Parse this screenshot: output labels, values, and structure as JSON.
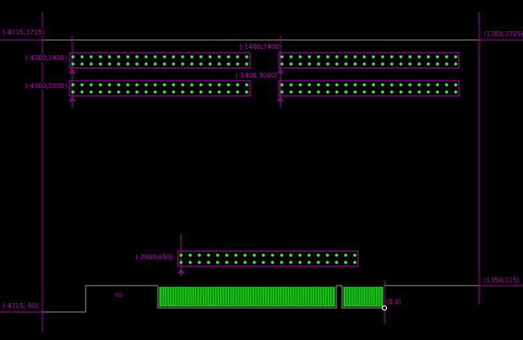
{
  "colors": {
    "background": "#000000",
    "outline": "#9a9a9a",
    "marker": "#b000b0",
    "connector_outline": "#c000c0",
    "pin": "#22ff22",
    "finger": "#0a8a0a",
    "finger_edge": "#2cff2c",
    "origin_marker": "#ffffff"
  },
  "labels": {
    "top_left": "(-4715,3715)",
    "top_right": "(1350,3715)",
    "hdr1_left": "(-4300,3400)",
    "hdr1_right": "(-1400,3400)",
    "hdr2_left": "(-4300,3000)",
    "hdr2_right": "(-1400,3000)",
    "hdr3": "(-2800,650)",
    "bottom_left": "(-4715,-50)",
    "bottom_right": "(1350,315)",
    "origin": "(0,0)",
    "note": "no"
  },
  "connectors": {
    "row_pin_count": 20,
    "lower_pin_count": 20,
    "edge_finger_count_main": 70,
    "edge_finger_count_small": 16
  }
}
